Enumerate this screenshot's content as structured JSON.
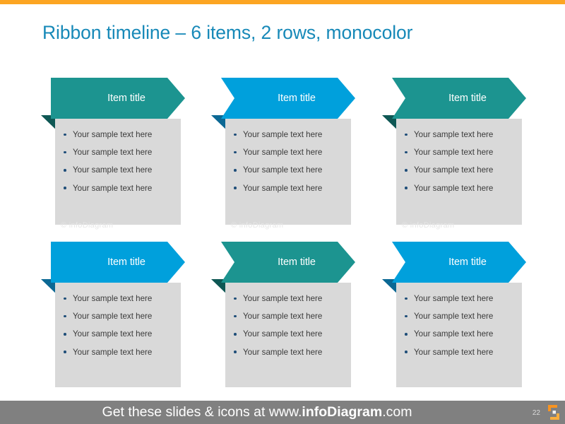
{
  "slide": {
    "title": "Ribbon timeline – 6 items, 2 rows, monocolor",
    "page_number": "22",
    "watermark": "© infoDiagram",
    "colors": {
      "title": "#1789B8",
      "teal": "#1C9490",
      "teal_fold": "#0E5754",
      "blue": "#00A0DC",
      "blue_fold": "#0B6894",
      "body": "#D9D9D9",
      "bullet": "#1F4E79",
      "bullet_text": "#3A3A3A",
      "accent_orange": "#FCA522",
      "footer": "#808080"
    }
  },
  "footer": {
    "prefix": "Get these slides & icons at www.",
    "brand": "infoDiagram",
    "suffix": ".com",
    "logo_icon": "infodiagram-logo-icon"
  },
  "items": [
    {
      "title": "Item title",
      "color": "teal",
      "left_notch": false,
      "bullets": [
        "Your sample text here",
        "Your sample text here",
        "Your sample text here",
        "Your sample text here"
      ]
    },
    {
      "title": "Item title",
      "color": "blue",
      "left_notch": true,
      "bullets": [
        "Your sample text here",
        "Your sample text here",
        "Your sample text here",
        "Your sample text here"
      ]
    },
    {
      "title": "Item title",
      "color": "teal",
      "left_notch": true,
      "bullets": [
        "Your sample text here",
        "Your sample text here",
        "Your sample text here",
        "Your sample text here"
      ]
    },
    {
      "title": "Item title",
      "color": "blue",
      "left_notch": false,
      "bullets": [
        "Your sample text here",
        "Your sample text here",
        "Your sample text here",
        "Your sample text here"
      ]
    },
    {
      "title": "Item title",
      "color": "teal",
      "left_notch": true,
      "bullets": [
        "Your sample text here",
        "Your sample text here",
        "Your sample text here",
        "Your sample text here"
      ]
    },
    {
      "title": "Item title",
      "color": "blue",
      "left_notch": true,
      "bullets": [
        "Your sample text here",
        "Your sample text here",
        "Your sample text here",
        "Your sample text here"
      ]
    }
  ]
}
